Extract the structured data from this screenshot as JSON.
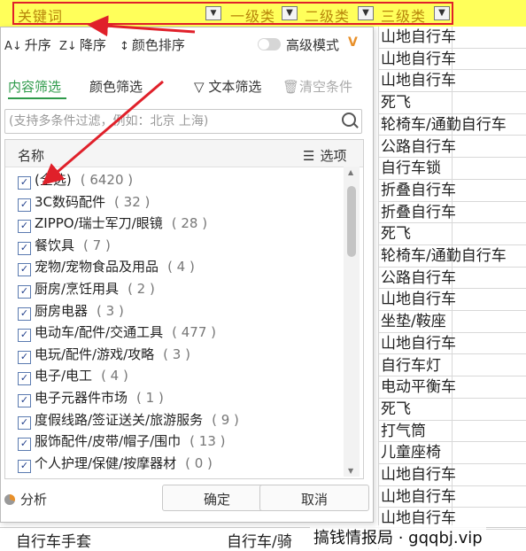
{
  "header": {
    "col1": "关键词",
    "col2": "一级类",
    "col3": "二级类",
    "col4": "三级类",
    "filter_icon": "funnel-filter-icon",
    "dropdown_icon": "chevron-down-icon"
  },
  "right_column": [
    "山地自行车",
    "山地自行车",
    "山地自行车",
    "死飞",
    "轮椅车/通勤自行车",
    "公路自行车",
    "自行车锁",
    "折叠自行车",
    "折叠自行车",
    "死飞",
    "轮椅车/通勤自行车",
    "公路自行车",
    "山地自行车",
    "坐垫/鞍座",
    "山地自行车",
    "自行车灯",
    "电动平衡车",
    "死飞",
    "打气筒",
    "儿童座椅",
    "山地自行车",
    "山地自行车",
    "山地自行车"
  ],
  "bottom_row": {
    "cell1": "自行车手套",
    "cell2": "自行车/骑"
  },
  "watermark": "搞钱情报局 · gqqbj.vip",
  "dialog": {
    "sort_asc": "升序",
    "sort_desc": "降序",
    "sort_color": "颜色排序",
    "advanced_mode": "高级模式",
    "vip_badge": "V",
    "tab_content": "内容筛选",
    "tab_color": "颜色筛选",
    "text_filter": "文本筛选",
    "clear_condition": "清空条件",
    "search_placeholder": "(支持多条件过滤，例如：北京 上海)",
    "list_header_name": "名称",
    "list_header_options": "选项",
    "items": [
      {
        "label": "(全选)",
        "count": "( 6420 )"
      },
      {
        "label": "3C数码配件",
        "count": "( 32 )"
      },
      {
        "label": "ZIPPO/瑞士军刀/眼镜",
        "count": "( 28 )"
      },
      {
        "label": "餐饮具",
        "count": "( 7 )"
      },
      {
        "label": "宠物/宠物食品及用品",
        "count": "( 4 )"
      },
      {
        "label": "厨房/烹饪用具",
        "count": "( 2 )"
      },
      {
        "label": "厨房电器",
        "count": "( 3 )"
      },
      {
        "label": "电动车/配件/交通工具",
        "count": "( 477 )"
      },
      {
        "label": "电玩/配件/游戏/攻略",
        "count": "( 3 )"
      },
      {
        "label": "电子/电工",
        "count": "( 4 )"
      },
      {
        "label": "电子元器件市场",
        "count": "( 1 )"
      },
      {
        "label": "度假线路/签证送关/旅游服务",
        "count": "( 9 )"
      },
      {
        "label": "服饰配件/皮带/帽子/围巾",
        "count": "( 13 )"
      },
      {
        "label": "个人护理/保健/按摩器材",
        "count": "( 0 )"
      }
    ],
    "analyze": "分析",
    "ok": "确定",
    "cancel": "取消"
  },
  "colors": {
    "header_bg": "#ffff5a",
    "highlight_red": "#e0202a",
    "tab_active": "#2e9a4a"
  }
}
